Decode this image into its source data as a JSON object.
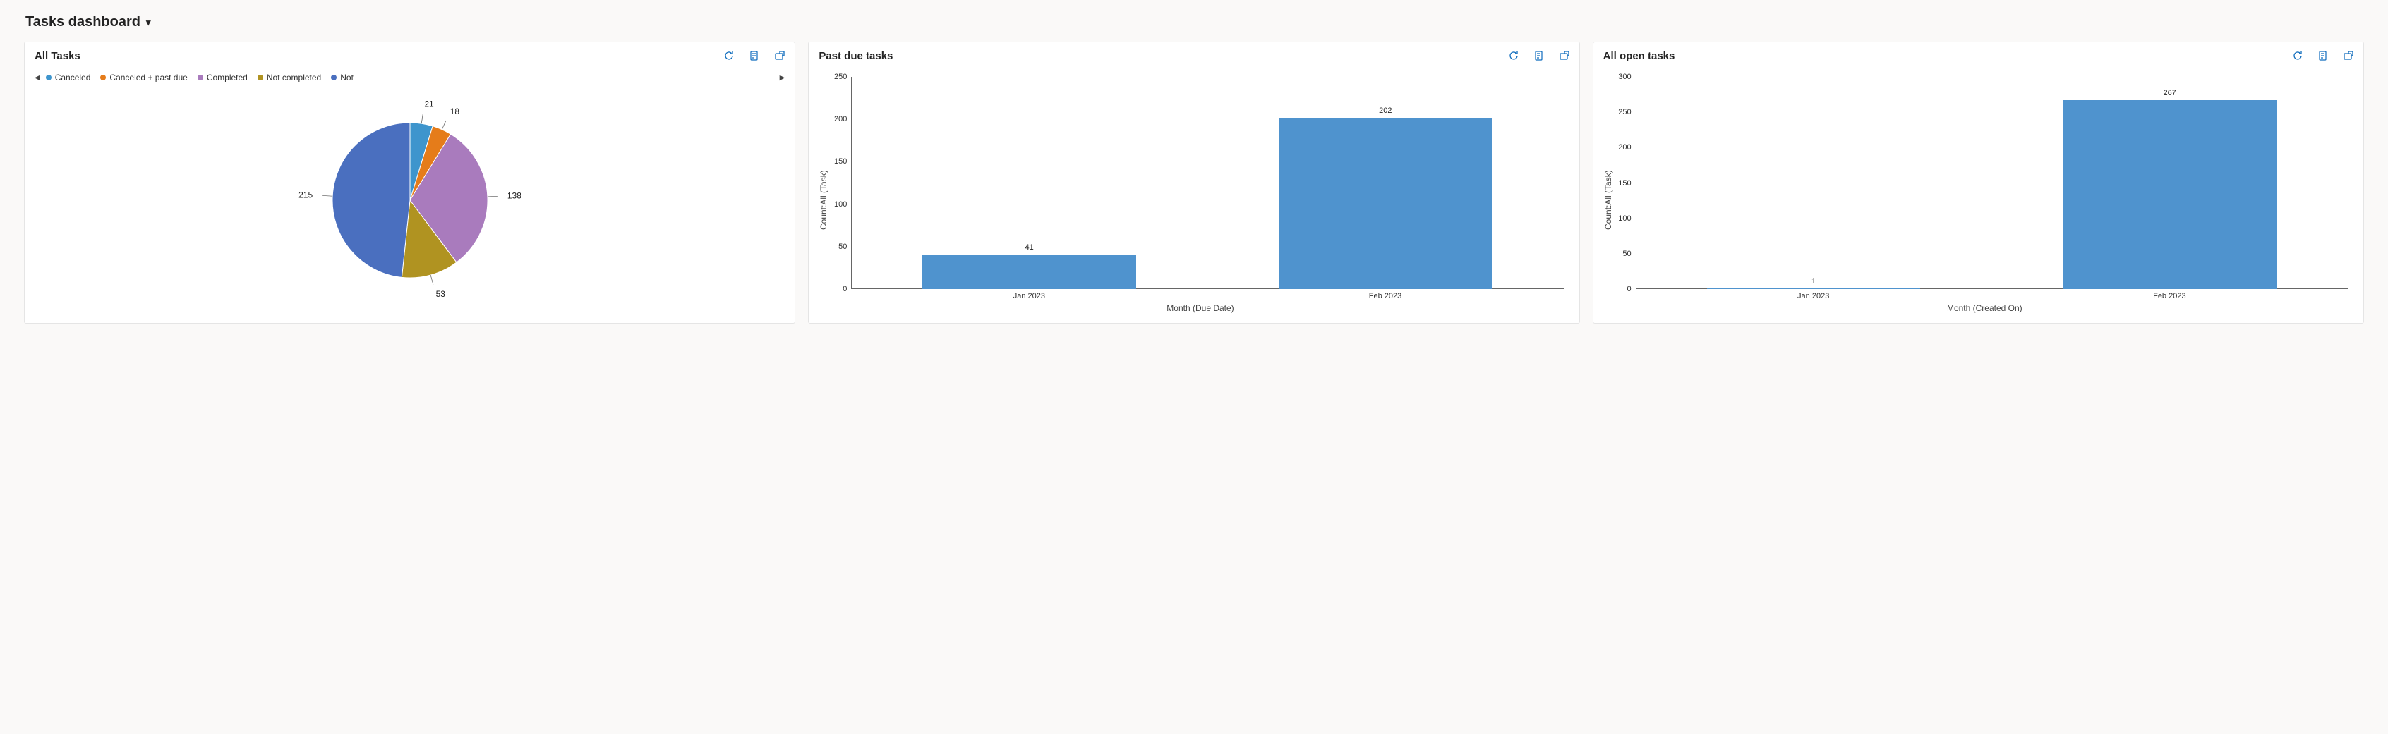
{
  "header": {
    "title": "Tasks dashboard"
  },
  "card1": {
    "title": "All Tasks",
    "legend_items": [
      {
        "label": "Canceled",
        "color": "#3e95cd"
      },
      {
        "label": "Canceled + past due",
        "color": "#e57c1a"
      },
      {
        "label": "Completed",
        "color": "#a97bbd"
      },
      {
        "label": "Not completed",
        "color": "#b09321"
      },
      {
        "label": "Not",
        "color": "#4a6fbf"
      }
    ]
  },
  "card2": {
    "title": "Past due tasks"
  },
  "card3": {
    "title": "All open tasks"
  },
  "chart_data": [
    {
      "type": "pie",
      "title": "All Tasks",
      "series": [
        {
          "name": "Canceled",
          "value": 21,
          "color": "#3e95cd"
        },
        {
          "name": "Canceled + past due",
          "value": 18,
          "color": "#e57c1a"
        },
        {
          "name": "Completed",
          "value": 138,
          "color": "#a97bbd"
        },
        {
          "name": "Not completed",
          "value": 53,
          "color": "#b09321"
        },
        {
          "name": "Not started",
          "value": 215,
          "color": "#4a6fbf"
        }
      ],
      "labels_shown": [
        21,
        18,
        138,
        53,
        215
      ]
    },
    {
      "type": "bar",
      "title": "Past due tasks",
      "categories": [
        "Jan 2023",
        "Feb 2023"
      ],
      "values": [
        41,
        202
      ],
      "ylabel": "Count:All (Task)",
      "xlabel": "Month (Due Date)",
      "ylim": [
        0,
        250
      ],
      "y_ticks": [
        0,
        50,
        100,
        150,
        200,
        250
      ],
      "bar_color": "#4f93ce"
    },
    {
      "type": "bar",
      "title": "All open tasks",
      "categories": [
        "Jan 2023",
        "Feb 2023"
      ],
      "values": [
        1,
        267
      ],
      "ylabel": "Count:All (Task)",
      "xlabel": "Month (Created On)",
      "ylim": [
        0,
        300
      ],
      "y_ticks": [
        0,
        50,
        100,
        150,
        200,
        250,
        300
      ],
      "bar_color": "#4f93ce"
    }
  ]
}
